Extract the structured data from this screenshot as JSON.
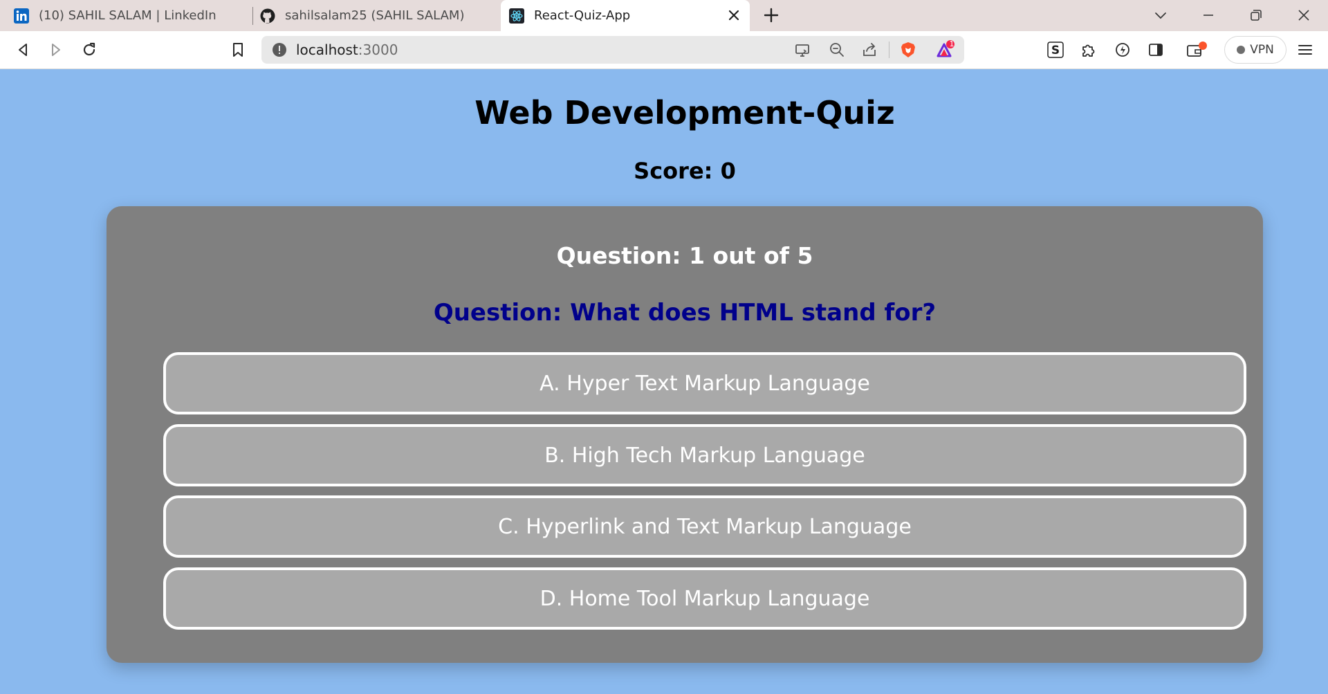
{
  "browser": {
    "tabs": [
      {
        "title": "(10) SAHIL SALAM | LinkedIn",
        "favicon": "linkedin-icon"
      },
      {
        "title": "sahilsalam25 (SAHIL SALAM)",
        "favicon": "github-icon"
      },
      {
        "title": "React-Quiz-App",
        "favicon": "react-icon",
        "active": true
      }
    ],
    "url_host": "localhost",
    "url_port": ":3000",
    "vpn_label": "VPN",
    "notification_badge": "1",
    "colors": {
      "brave_orange": "#fb542b",
      "tabstrip": "#e6dcdb"
    }
  },
  "page": {
    "title": "Web Development-Quiz",
    "score_text": "Score: 0",
    "question_count": "Question: 1 out of 5",
    "question_text": "Question: What does HTML stand for?",
    "options": [
      "A. Hyper Text Markup Language",
      "B. High Tech Markup Language",
      "C. Hyperlink and Text Markup Language",
      "D. Home Tool Markup Language"
    ],
    "colors": {
      "background": "#8ab9ee",
      "card": "#808080",
      "option": "#a9a9a9",
      "question": "#00008b"
    }
  }
}
